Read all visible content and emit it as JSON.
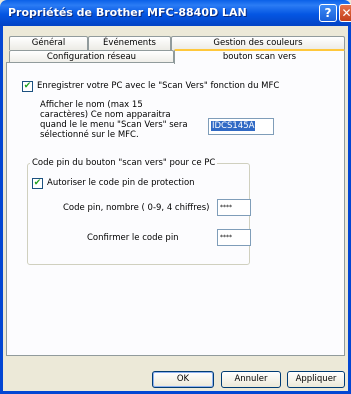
{
  "window": {
    "title": "Propriétés de Brother MFC-8840D LAN",
    "help_label": "?",
    "close_label": "✕"
  },
  "tabs": {
    "row1": [
      "Général",
      "Événements",
      "Gestion des couleurs"
    ],
    "row2": [
      "Configuration réseau",
      "bouton scan vers"
    ],
    "active": "bouton scan vers"
  },
  "register": {
    "label": "Enregistrer votre PC avec le \"Scan Vers\" fonction du MFC",
    "checked": true,
    "check_glyph": "✔"
  },
  "name_section": {
    "description": "Afficher le nom (max 15 caractères) Ce nom apparaitra quand le le menu \"Scan Vers\" sera sélectionné sur le MFC.",
    "name_value": "IDCS145A"
  },
  "pin_group": {
    "legend": "Code pin du bouton \"scan vers\" pour ce PC",
    "enable_label": "Autoriser le code pin de protection",
    "enable_checked": true,
    "pin_label": "Code pin, nombre ( 0-9, 4 chiffres)",
    "pin_value": "****",
    "confirm_label": "Confirmer le code pin",
    "confirm_value": "****"
  },
  "buttons": {
    "ok": "OK",
    "cancel": "Annuler",
    "apply": "Appliquer"
  }
}
